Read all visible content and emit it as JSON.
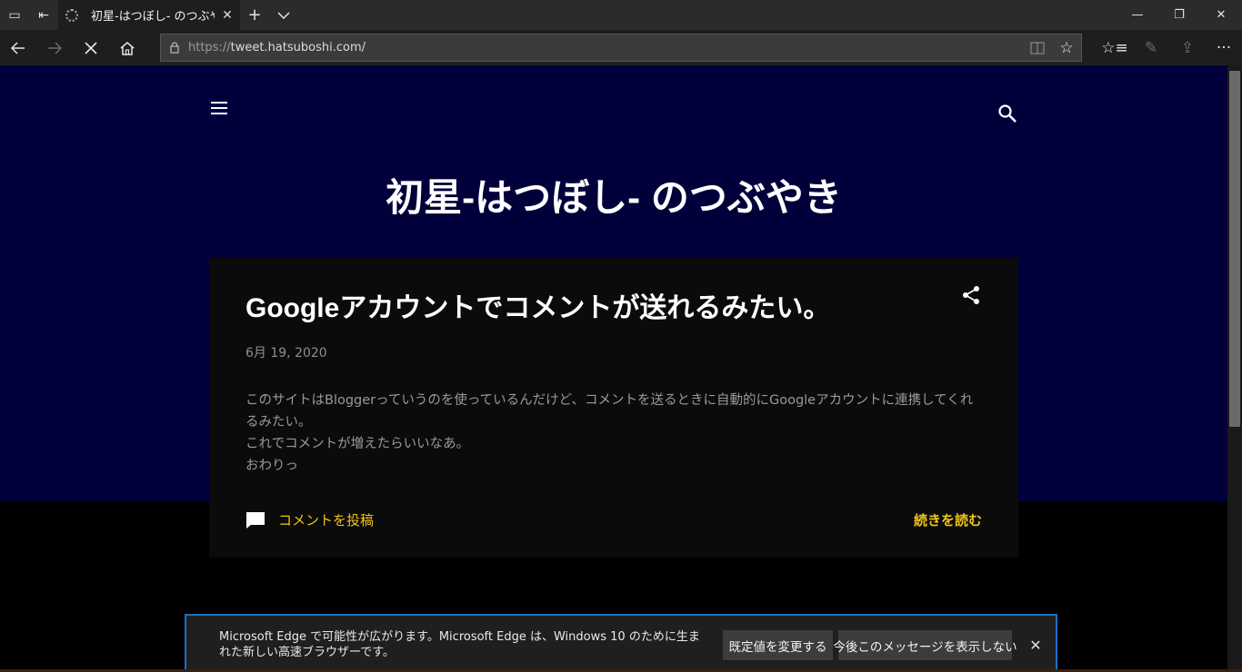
{
  "browser": {
    "tab_title": "初星-はつぼし- のつぶやき",
    "url_protocol": "https://",
    "url_rest": "tweet.hatsuboshi.com/",
    "icons": {
      "tab_actions": "tab-actions-icon",
      "set_aside": "set-aside-tabs-icon",
      "loading": "loading-spinner-icon",
      "close_tab": "close-icon",
      "new_tab": "plus-icon",
      "tab_preview": "chevron-down-icon",
      "back": "back-arrow-icon",
      "forward": "forward-arrow-icon",
      "stop": "stop-icon",
      "home": "home-icon",
      "lock": "lock-icon",
      "reading_view": "reading-view-icon",
      "favorite": "star-icon",
      "favorites_hub": "favorites-hub-icon",
      "notes": "pen-icon",
      "share": "share-icon",
      "more": "more-icon"
    }
  },
  "blog": {
    "title": "初星-はつぼし- のつぶやき",
    "header_bg": "#02003b",
    "accent": "#f0c419"
  },
  "post": {
    "title": "Googleアカウントでコメントが送れるみたい。",
    "date": "6月 19, 2020",
    "body_lines": [
      "このサイトはBloggerっていうのを使っているんだけど、コメントを送るときに自動的にGoogleアカウントに連携してくれるみたい。",
      "これでコメントが増えたらいいなあ。",
      "おわりっ"
    ],
    "comment_label": "コメントを投稿",
    "read_more_label": "続きを読む"
  },
  "notification": {
    "message": "Microsoft Edge で可能性が広がります。Microsoft Edge は、Windows 10 のために生まれた新しい高速ブラウザーです。",
    "button_change_default": "既定値を変更する",
    "button_dont_show": "今後このメッセージを表示しない"
  }
}
